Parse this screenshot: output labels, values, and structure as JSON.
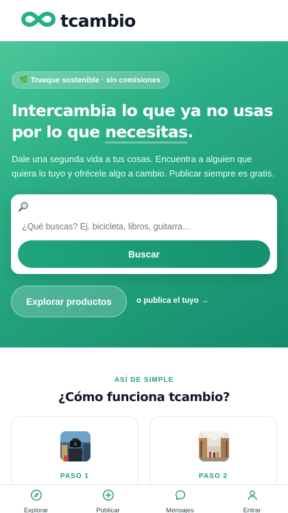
{
  "header": {
    "brand": "tcambio",
    "icon": "infinity-logo-icon"
  },
  "hero": {
    "chip_icon": "leaf-icon",
    "chip_text": "Trueque sostenible · sin comisiones",
    "headline_line1": "Intercambia lo que ya no usas",
    "headline_prefix": "por lo que ",
    "headline_highlight": "necesitas",
    "headline_suffix": ".",
    "subtext": "Dale una segunda vida a tus cosas. Encuentra a alguien que quiera lo tuyo y ofrécele algo a cambio. Publicar siempre es gratis.",
    "search": {
      "icon": "search-icon",
      "placeholder": "¿Qué buscas? Ej. bicicleta, libros, guitarra…",
      "button": "Buscar"
    },
    "explore_button": "Explorar productos",
    "publish_link": "o publica el tuyo →"
  },
  "how": {
    "eyebrow": "ASÍ DE SIMPLE",
    "title": "¿Cómo funciona tcambio?",
    "steps": [
      {
        "label": "PASO 1",
        "image": "photographer-photo"
      },
      {
        "label": "PASO 2",
        "image": "market-hall-photo"
      }
    ]
  },
  "nav": {
    "items": [
      {
        "label": "Explorar",
        "icon": "compass-icon"
      },
      {
        "label": "Publicar",
        "icon": "plus-circle-icon"
      },
      {
        "label": "Mensajes",
        "icon": "chat-bubble-icon"
      },
      {
        "label": "Entrar",
        "icon": "user-icon"
      }
    ]
  },
  "colors": {
    "brand": "#1e9c78",
    "brand_light": "#4cc79a",
    "text": "#111827"
  }
}
